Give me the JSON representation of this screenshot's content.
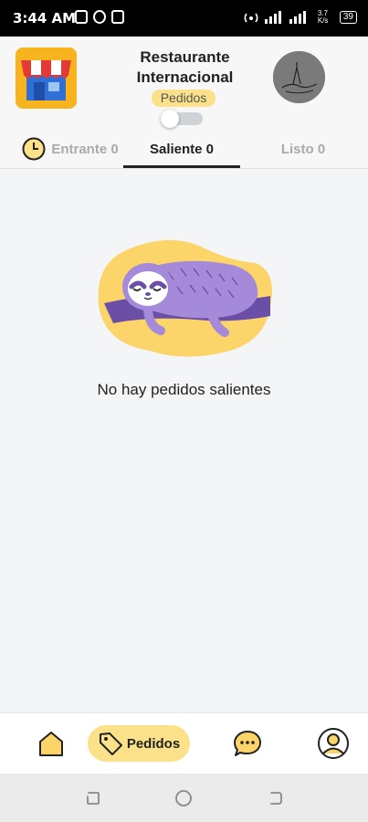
{
  "status_bar": {
    "time": "3:44 AM",
    "speed": "3.7 K/s",
    "battery": "39"
  },
  "header": {
    "title": "Restaurante Internacional",
    "badge": "Pedidos",
    "toggle_on": false,
    "accent_color": "#fbe28a"
  },
  "tabs": [
    {
      "label": "Entrante 0",
      "active": false
    },
    {
      "label": "Saliente 0",
      "active": true
    },
    {
      "label": "Listo 0",
      "active": false
    }
  ],
  "empty_state": {
    "message": "No hay pedidos salientes",
    "illustration": "sleeping-sloth"
  },
  "bottom_nav": {
    "items": [
      {
        "icon": "home-icon",
        "label": ""
      },
      {
        "icon": "tag-icon",
        "label": "Pedidos",
        "active": true
      },
      {
        "icon": "chat-icon",
        "label": ""
      },
      {
        "icon": "profile-icon",
        "label": ""
      }
    ]
  },
  "system_nav": [
    "recent-apps",
    "home",
    "back"
  ]
}
